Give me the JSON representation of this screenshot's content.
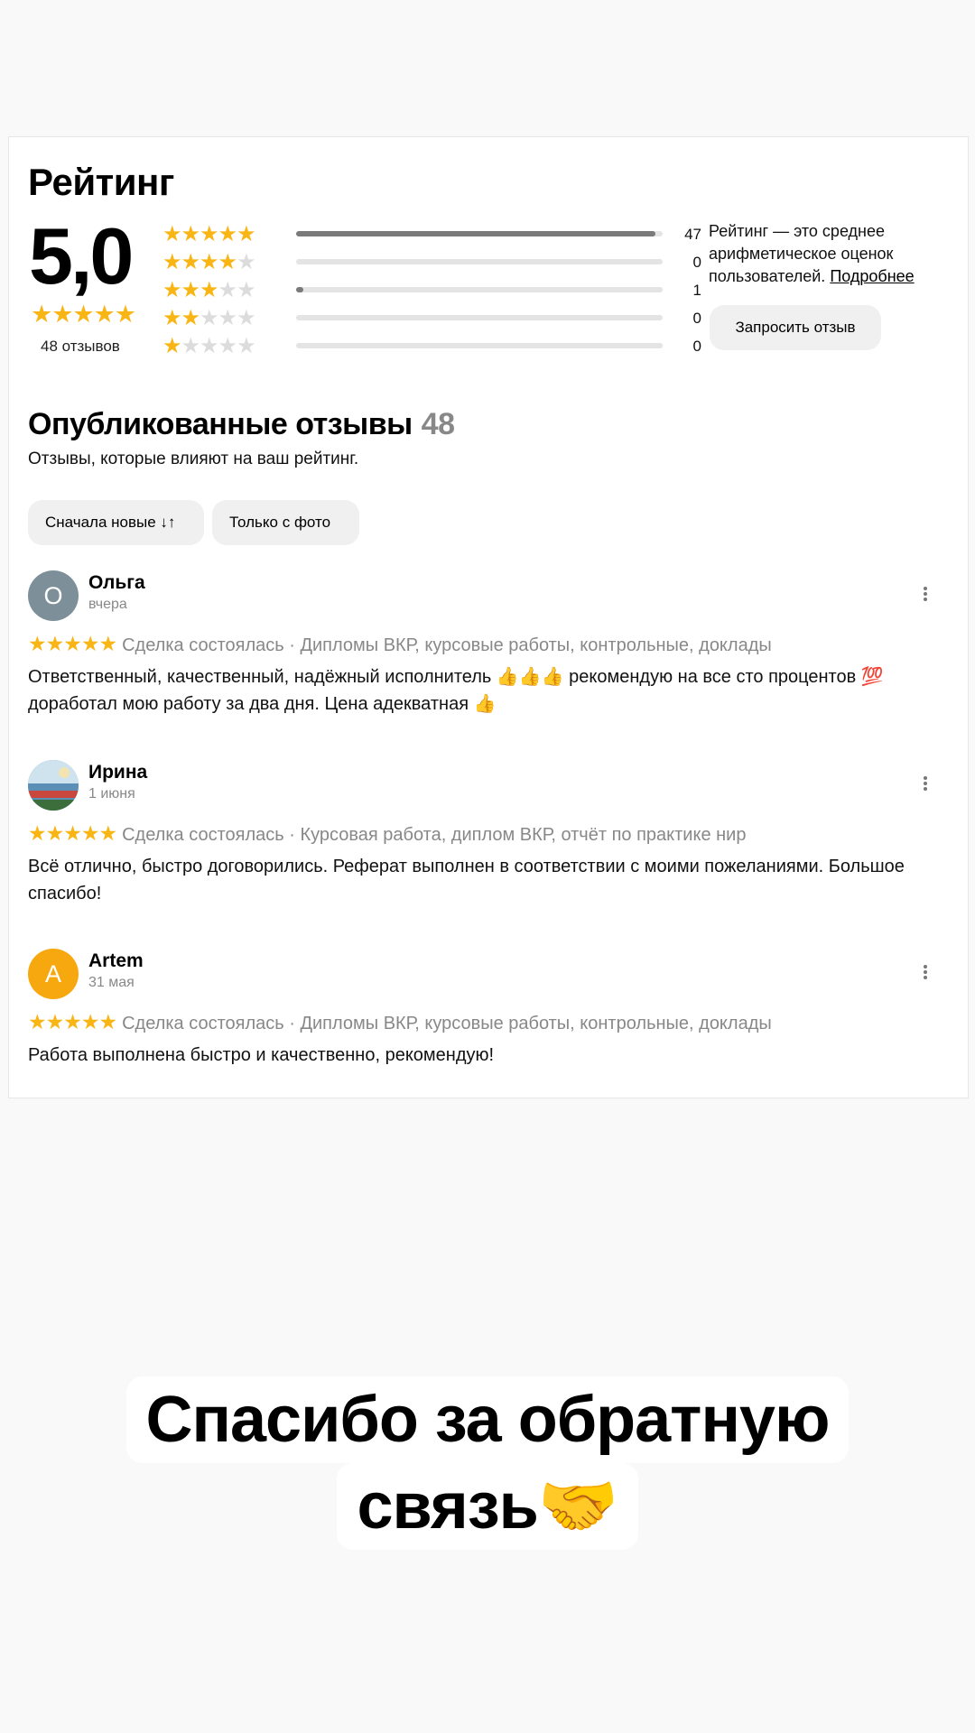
{
  "rating": {
    "title": "Рейтинг",
    "score": "5,0",
    "stars": "★★★★★",
    "review_count": "48 отзывов",
    "distribution": [
      {
        "stars": 5,
        "count": "47",
        "fill": 0.98
      },
      {
        "stars": 4,
        "count": "0",
        "fill": 0
      },
      {
        "stars": 3,
        "count": "1",
        "fill": 0.02
      },
      {
        "stars": 2,
        "count": "0",
        "fill": 0
      },
      {
        "stars": 1,
        "count": "0",
        "fill": 0
      }
    ],
    "explanation": "Рейтинг — это среднее арифметическое оценок пользователей.",
    "more_link": "Подробнее",
    "request_button": "Запросить отзыв"
  },
  "published": {
    "title": "Опубликованные отзывы",
    "count": "48",
    "subtitle": "Отзывы, которые влияют на ваш рейтинг.",
    "sort_chip": "Сначала новые ↓↑",
    "photo_chip": "Только с фото"
  },
  "reviews": [
    {
      "initial": "О",
      "avatar_color": "#7d8f99",
      "name": "Ольга",
      "date": "вчера",
      "stars": "★★★★★",
      "meta": "Сделка состоялась · Дипломы ВКР, курсовые работы, контрольные, доклады",
      "text": "Ответственный, качественный, надёжный исполнитель 👍👍👍 рекомендую на все сто процентов 💯 доработал мою работу за два дня. Цена адекватная 👍"
    },
    {
      "initial": "",
      "avatar_color": "#4a7fa8",
      "name": "Ирина",
      "date": "1 июня",
      "stars": "★★★★★",
      "meta": "Сделка состоялась · Курсовая работа, диплом ВКР, отчёт по практике нир",
      "text": "Всё отлично, быстро договорились. Реферат выполнен в соответствии с моими пожеланиями. Большое спасибо!"
    },
    {
      "initial": "A",
      "avatar_color": "#f8a80f",
      "name": "Artem",
      "date": "31 мая",
      "stars": "★★★★★",
      "meta": "Сделка состоялась · Дипломы ВКР, курсовые работы, контрольные, доклады",
      "text": "Работа выполнена быстро и качественно, рекомендую!"
    }
  ],
  "caption": {
    "line1": "Спасибо за обратную",
    "line2": "связь🤝"
  }
}
